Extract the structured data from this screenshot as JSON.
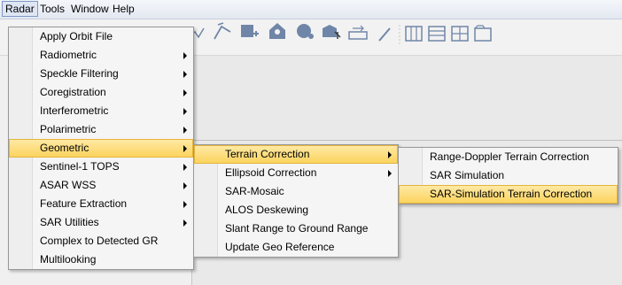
{
  "menubar": {
    "items": [
      "Radar",
      "Tools",
      "Window",
      "Help"
    ]
  },
  "radar_menu": {
    "items": [
      {
        "label": "Apply Orbit File",
        "submenu": false
      },
      {
        "label": "Radiometric",
        "submenu": true
      },
      {
        "label": "Speckle Filtering",
        "submenu": true
      },
      {
        "label": "Coregistration",
        "submenu": true
      },
      {
        "label": "Interferometric",
        "submenu": true
      },
      {
        "label": "Polarimetric",
        "submenu": true
      },
      {
        "label": "Geometric",
        "submenu": true
      },
      {
        "label": "Sentinel-1 TOPS",
        "submenu": true
      },
      {
        "label": "ASAR WSS",
        "submenu": true
      },
      {
        "label": "Feature Extraction",
        "submenu": true
      },
      {
        "label": "SAR Utilities",
        "submenu": true
      },
      {
        "label": "Complex to Detected GR",
        "submenu": false
      },
      {
        "label": "Multilooking",
        "submenu": false
      }
    ],
    "selected": "Geometric"
  },
  "geometric_menu": {
    "items": [
      {
        "label": "Terrain Correction",
        "submenu": true
      },
      {
        "label": "Ellipsoid Correction",
        "submenu": true
      },
      {
        "label": "SAR-Mosaic",
        "submenu": false
      },
      {
        "label": "ALOS Deskewing",
        "submenu": false
      },
      {
        "label": "Slant Range to Ground Range",
        "submenu": false
      },
      {
        "label": "Update Geo Reference",
        "submenu": false
      }
    ],
    "selected": "Terrain Correction"
  },
  "terrain_menu": {
    "items": [
      {
        "label": "Range-Doppler Terrain Correction",
        "submenu": false
      },
      {
        "label": "SAR Simulation",
        "submenu": false
      },
      {
        "label": "SAR-Simulation Terrain Correction",
        "submenu": false
      }
    ],
    "selected": "SAR-Simulation Terrain Correction"
  },
  "toolbar_icons": [
    "polyline-icon",
    "pan-icon",
    "add-shape-icon",
    "layer-icon",
    "globe-icon",
    "import-icon",
    "ruler-icon",
    "wand-icon",
    "tile-vertical-icon",
    "tile-horizontal-icon",
    "tile-grid-icon",
    "window-icon"
  ],
  "colors": {
    "highlight_top": "#ffeaa8",
    "highlight_bottom": "#fbd25a"
  }
}
